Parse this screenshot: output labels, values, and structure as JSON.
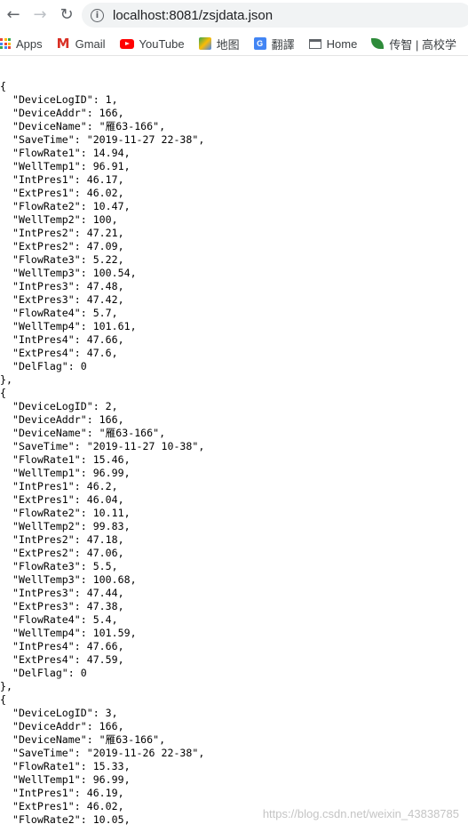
{
  "browser": {
    "url": "localhost:8081/zsjdata.json",
    "bookmarks": [
      "Apps",
      "Gmail",
      "YouTube",
      "地图",
      "翻譯",
      "Home",
      "传智 | 高校学"
    ]
  },
  "json_lines": [
    "{",
    "  \"DeviceLogID\": 1,",
    "  \"DeviceAddr\": 166,",
    "  \"DeviceName\": \"雁63-166\",",
    "  \"SaveTime\": \"2019-11-27 22-38\",",
    "  \"FlowRate1\": 14.94,",
    "  \"WellTemp1\": 96.91,",
    "  \"IntPres1\": 46.17,",
    "  \"ExtPres1\": 46.02,",
    "  \"FlowRate2\": 10.47,",
    "  \"WellTemp2\": 100,",
    "  \"IntPres2\": 47.21,",
    "  \"ExtPres2\": 47.09,",
    "  \"FlowRate3\": 5.22,",
    "  \"WellTemp3\": 100.54,",
    "  \"IntPres3\": 47.48,",
    "  \"ExtPres3\": 47.42,",
    "  \"FlowRate4\": 5.7,",
    "  \"WellTemp4\": 101.61,",
    "  \"IntPres4\": 47.66,",
    "  \"ExtPres4\": 47.6,",
    "  \"DelFlag\": 0",
    "},",
    "{",
    "  \"DeviceLogID\": 2,",
    "  \"DeviceAddr\": 166,",
    "  \"DeviceName\": \"雁63-166\",",
    "  \"SaveTime\": \"2019-11-27 10-38\",",
    "  \"FlowRate1\": 15.46,",
    "  \"WellTemp1\": 96.99,",
    "  \"IntPres1\": 46.2,",
    "  \"ExtPres1\": 46.04,",
    "  \"FlowRate2\": 10.11,",
    "  \"WellTemp2\": 99.83,",
    "  \"IntPres2\": 47.18,",
    "  \"ExtPres2\": 47.06,",
    "  \"FlowRate3\": 5.5,",
    "  \"WellTemp3\": 100.68,",
    "  \"IntPres3\": 47.44,",
    "  \"ExtPres3\": 47.38,",
    "  \"FlowRate4\": 5.4,",
    "  \"WellTemp4\": 101.59,",
    "  \"IntPres4\": 47.66,",
    "  \"ExtPres4\": 47.59,",
    "  \"DelFlag\": 0",
    "},",
    "{",
    "  \"DeviceLogID\": 3,",
    "  \"DeviceAddr\": 166,",
    "  \"DeviceName\": \"雁63-166\",",
    "  \"SaveTime\": \"2019-11-26 22-38\",",
    "  \"FlowRate1\": 15.33,",
    "  \"WellTemp1\": 96.99,",
    "  \"IntPres1\": 46.19,",
    "  \"ExtPres1\": 46.02,",
    "  \"FlowRate2\": 10.05,"
  ],
  "watermark": "https://blog.csdn.net/weixin_43838785",
  "colors": {
    "omnibox_bg": "#f1f3f4",
    "youtube_red": "#ff0000",
    "gmail_red": "#d93025"
  }
}
